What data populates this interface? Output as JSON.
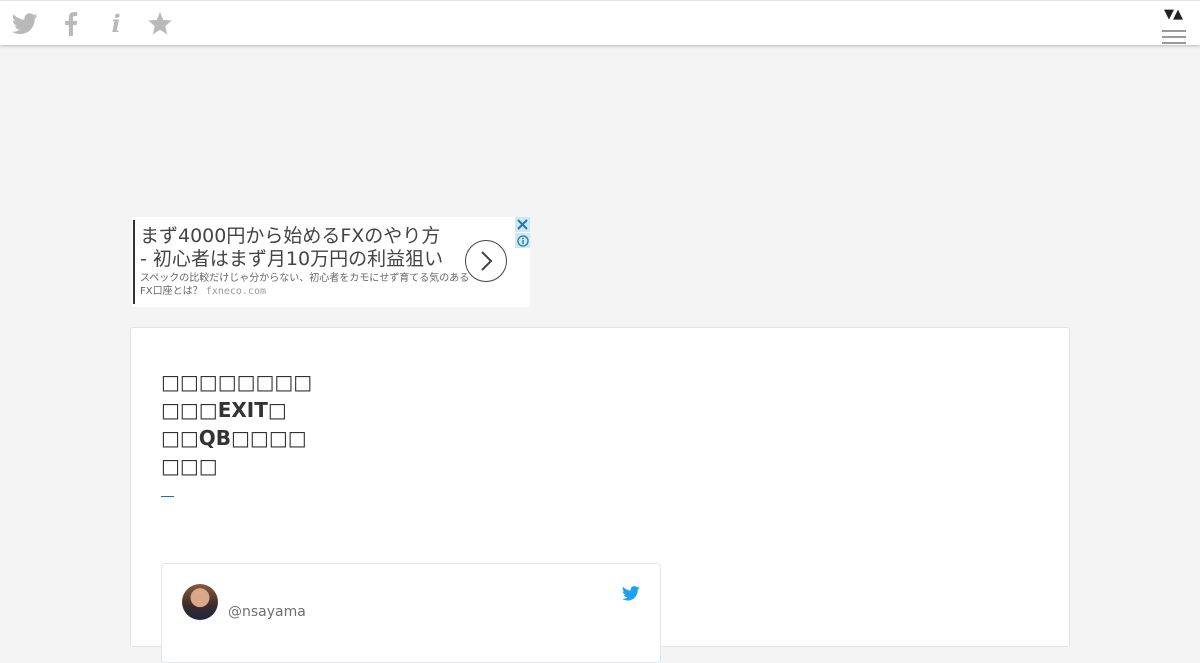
{
  "topbar": {
    "icons": [
      "twitter-icon",
      "facebook-icon",
      "info-icon",
      "star-icon",
      "menu-icon"
    ],
    "info_glyph": "i",
    "arrows": "▼▲"
  },
  "ad": {
    "headline_1": "まず4000円から始めるFXのやり方",
    "headline_2": "- 初心者はまず月10万円の利益狙い",
    "description": "スペックの比較だけじゃ分からない、初心者をカモにせず育てる気のあるFX口座とは？",
    "domain": "fxneco.com"
  },
  "article": {
    "title_lines": [
      "□□□□□□□□",
      "□□□EXIT□",
      "□□QB□□□□",
      "□□□"
    ],
    "tweet": {
      "handle": "@nsayama"
    }
  },
  "colors": {
    "background": "#f4f4f4",
    "accent": "#1a6fbd",
    "twitter_blue": "#1da1f2"
  }
}
